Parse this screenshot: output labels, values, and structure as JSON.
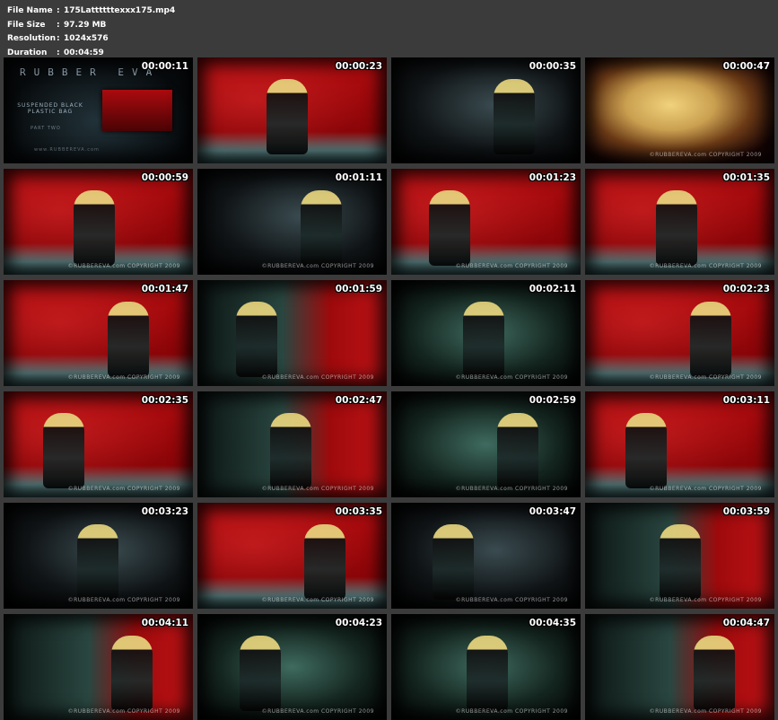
{
  "info": {
    "file_name_key": "File Name",
    "file_name_value": "175Lattttttexxx175.mp4",
    "file_size_key": "File Size",
    "file_size_value": "97.29 MB",
    "resolution_key": "Resolution",
    "resolution_value": "1024x576",
    "duration_key": "Duration",
    "duration_value": "00:04:59",
    "separator": ":"
  },
  "title_card": {
    "brand": "RUBBER EVA",
    "subtitle": "SUSPENDED BLACK PLASTIC BAG",
    "part": "PART TWO",
    "url": "www.RUBBEREVA.com"
  },
  "watermark": "©RUBBEREVA.com COPYRIGHT 2009",
  "thumbnails": [
    {
      "time": "00:00:11",
      "tone": "title",
      "watermark": false
    },
    {
      "time": "00:00:23",
      "tone": "red",
      "watermark": false
    },
    {
      "time": "00:00:35",
      "tone": "dark",
      "watermark": false
    },
    {
      "time": "00:00:47",
      "tone": "face",
      "watermark": true
    },
    {
      "time": "00:00:59",
      "tone": "red",
      "watermark": true
    },
    {
      "time": "00:01:11",
      "tone": "dark",
      "watermark": true
    },
    {
      "time": "00:01:23",
      "tone": "red",
      "watermark": true
    },
    {
      "time": "00:01:35",
      "tone": "red",
      "watermark": true
    },
    {
      "time": "00:01:47",
      "tone": "red",
      "watermark": true
    },
    {
      "time": "00:01:59",
      "tone": "mixed",
      "watermark": true
    },
    {
      "time": "00:02:11",
      "tone": "green",
      "watermark": true
    },
    {
      "time": "00:02:23",
      "tone": "red",
      "watermark": true
    },
    {
      "time": "00:02:35",
      "tone": "red",
      "watermark": true
    },
    {
      "time": "00:02:47",
      "tone": "mixed",
      "watermark": true
    },
    {
      "time": "00:02:59",
      "tone": "green",
      "watermark": true
    },
    {
      "time": "00:03:11",
      "tone": "red",
      "watermark": true
    },
    {
      "time": "00:03:23",
      "tone": "dark",
      "watermark": true
    },
    {
      "time": "00:03:35",
      "tone": "red",
      "watermark": true
    },
    {
      "time": "00:03:47",
      "tone": "dark",
      "watermark": true
    },
    {
      "time": "00:03:59",
      "tone": "mixed",
      "watermark": true
    },
    {
      "time": "00:04:11",
      "tone": "mixed",
      "watermark": true
    },
    {
      "time": "00:04:23",
      "tone": "green",
      "watermark": true
    },
    {
      "time": "00:04:35",
      "tone": "green",
      "watermark": true
    },
    {
      "time": "00:04:47",
      "tone": "mixed",
      "watermark": true
    }
  ],
  "colors": {
    "background": "#3b3b3b",
    "text": "#ffffff",
    "set_red": "#b50d10",
    "latex_teal": "#3f6b5f"
  }
}
